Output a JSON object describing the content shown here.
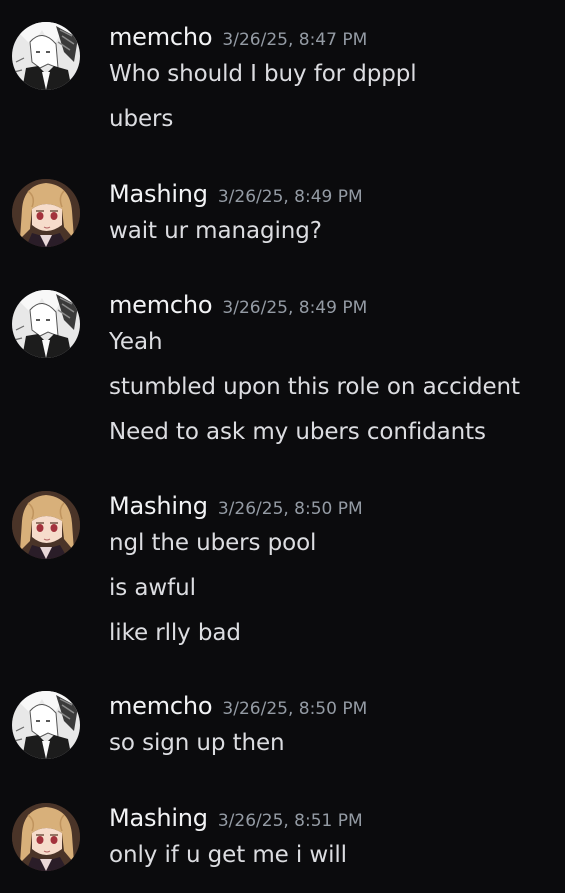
{
  "messages": [
    {
      "author": "memcho",
      "avatar_icon": "anime-white-hair-avatar",
      "timestamp": "3/26/25, 8:47 PM",
      "lines": [
        "Who should I buy for dpppl",
        "ubers"
      ]
    },
    {
      "author": "Mashing",
      "avatar_icon": "anime-blonde-girl-avatar",
      "timestamp": "3/26/25, 8:49 PM",
      "lines": [
        "wait ur managing?"
      ]
    },
    {
      "author": "memcho",
      "avatar_icon": "anime-white-hair-avatar",
      "timestamp": "3/26/25, 8:49 PM",
      "lines": [
        "Yeah",
        "stumbled upon this role on accident",
        "Need to ask my ubers confidants"
      ]
    },
    {
      "author": "Mashing",
      "avatar_icon": "anime-blonde-girl-avatar",
      "timestamp": "3/26/25, 8:50 PM",
      "lines": [
        "ngl the ubers pool",
        "is awful",
        "like rlly bad"
      ]
    },
    {
      "author": "memcho",
      "avatar_icon": "anime-white-hair-avatar",
      "timestamp": "3/26/25, 8:50 PM",
      "lines": [
        "so sign up then"
      ]
    },
    {
      "author": "Mashing",
      "avatar_icon": "anime-blonde-girl-avatar",
      "timestamp": "3/26/25, 8:51 PM",
      "lines": [
        "only if u get me i will"
      ]
    }
  ],
  "colors": {
    "background": "#0b0b0d",
    "username": "#f2f3f5",
    "timestamp": "#949ba4",
    "message_text": "#dcdde1"
  }
}
